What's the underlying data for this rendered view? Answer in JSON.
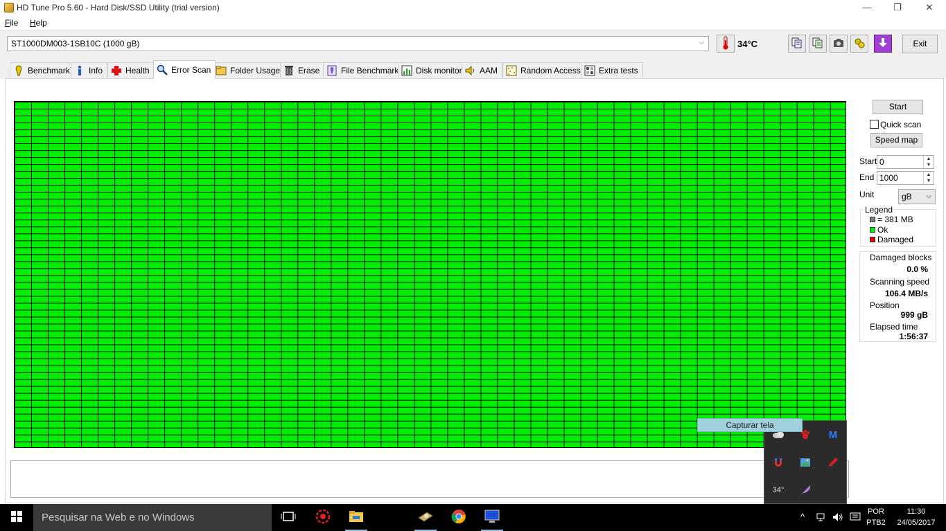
{
  "window": {
    "title": "HD Tune Pro 5.60 - Hard Disk/SSD Utility (trial version)",
    "controls": {
      "minimize": "—",
      "maximize": "❐",
      "close": "✕"
    }
  },
  "menu": [
    {
      "label": "File",
      "accel": "F",
      "rest": "ile"
    },
    {
      "label": "Help",
      "accel": "H",
      "rest": "elp"
    }
  ],
  "toolbar": {
    "drive": "ST1000DM003-1SB10C (1000 gB)",
    "temperature": "34°C",
    "exit_label": "Exit",
    "icons": [
      "copy-info-icon",
      "copy-text-icon",
      "camera-icon",
      "options-icon",
      "save-down-icon"
    ]
  },
  "tabs": [
    {
      "label": "Benchmark",
      "icon": "benchmark-icon"
    },
    {
      "label": "Info",
      "icon": "info-icon"
    },
    {
      "label": "Health",
      "icon": "health-icon"
    },
    {
      "label": "Error Scan",
      "icon": "magnifier-icon",
      "active": true
    },
    {
      "label": "Folder Usage",
      "icon": "folder-icon"
    },
    {
      "label": "Erase",
      "icon": "trash-icon"
    },
    {
      "label": "File Benchmark",
      "icon": "file-benchmark-icon"
    },
    {
      "label": "Disk monitor",
      "icon": "disk-monitor-icon"
    },
    {
      "label": "AAM",
      "icon": "speaker-icon"
    },
    {
      "label": "Random Access",
      "icon": "random-access-icon"
    },
    {
      "label": "Extra tests",
      "icon": "extra-tests-icon"
    }
  ],
  "scan": {
    "start_button": "Start",
    "quick_scan_label": "Quick scan",
    "quick_scan_checked": false,
    "speed_map_button": "Speed map",
    "start_label": "Start",
    "start_value": "0",
    "end_label": "End",
    "end_value": "1000",
    "unit_label": "Unit",
    "unit_value": "gB",
    "grid_status": "Ok",
    "grid_color": "#00ee00"
  },
  "legend": {
    "title": "Legend",
    "items": [
      {
        "label": "= 381 MB",
        "color": "#808080"
      },
      {
        "label": "Ok",
        "color": "#00ee00"
      },
      {
        "label": "Damaged",
        "color": "#e00000"
      }
    ]
  },
  "stats": {
    "damaged_label": "Damaged blocks",
    "damaged_value": "0.0 %",
    "speed_label": "Scanning speed",
    "speed_value": "106.4 MB/s",
    "position_label": "Position",
    "position_value": "999 gB",
    "elapsed_label": "Elapsed time",
    "elapsed_value": "1:56:37"
  },
  "tray_popup": {
    "tooltip": "Capturar tela",
    "temp_text": "34°"
  },
  "taskbar": {
    "search_placeholder": "Pesquisar na Web e no Windows",
    "language": "POR",
    "layout": "PTB2",
    "time": "11:30",
    "date": "24/05/2017"
  }
}
